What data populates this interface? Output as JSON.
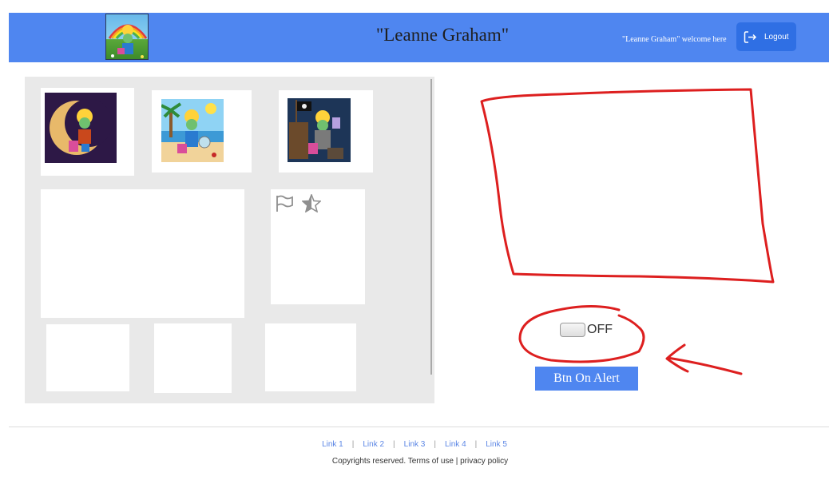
{
  "header": {
    "title": "\"Leanne Graham\"",
    "welcome": "\"Leanne Graham\" welcome here",
    "logout_label": "Logout",
    "background": "#4f86f0"
  },
  "gallery": {
    "images": [
      {
        "name": "moon"
      },
      {
        "name": "beach"
      },
      {
        "name": "pirate"
      }
    ],
    "icons": [
      "flag-icon",
      "star-icon"
    ]
  },
  "controls": {
    "toggle_label": "OFF",
    "toggle_on": false,
    "alert_button_label": "Btn On Alert"
  },
  "footer": {
    "links": [
      "Link 1",
      "Link 2",
      "Link 3",
      "Link 4",
      "Link 5"
    ],
    "separator": "|",
    "copyright": "Copyrights reserved. Terms of use | privacy policy"
  },
  "annotation_color": "#dd1f1f"
}
